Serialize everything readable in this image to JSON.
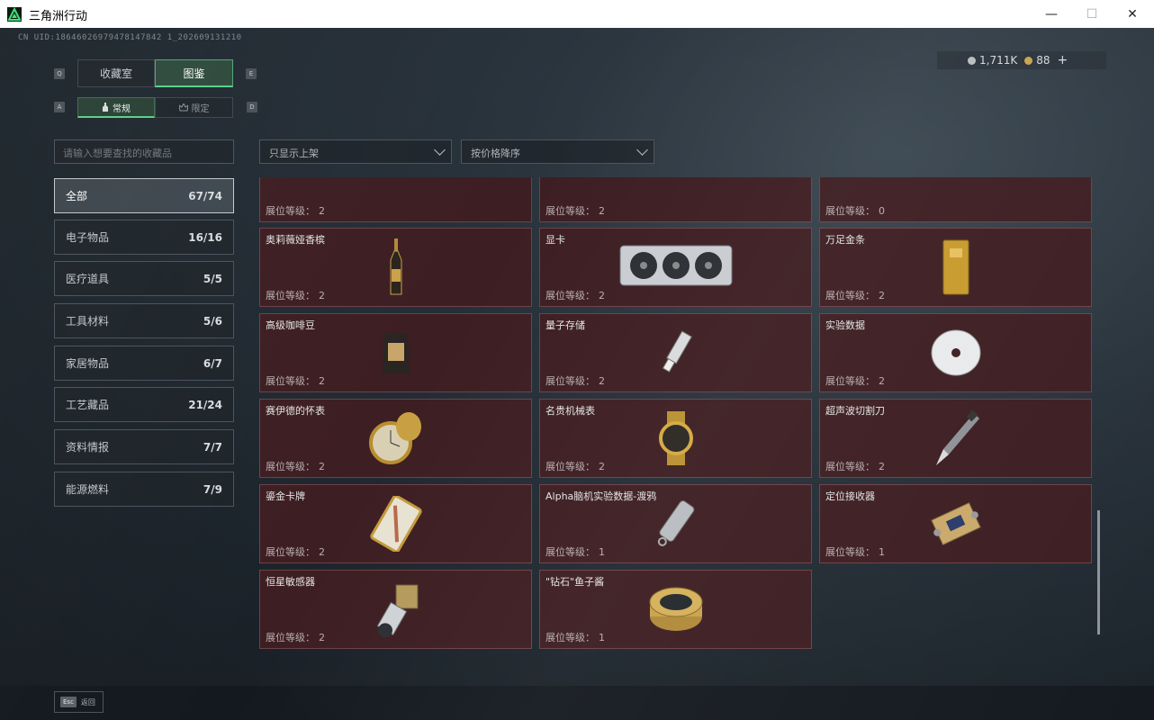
{
  "window": {
    "title": "三角洲行动",
    "minimize": "—",
    "maximize": "☐",
    "close": "✕"
  },
  "header": {
    "uid": "CN UID:18646026979478147842 1_202609131210"
  },
  "currency": {
    "silver": "1,711K",
    "gold": "88",
    "add": "+"
  },
  "keys": {
    "q": "Q",
    "e": "E",
    "a": "A",
    "d": "D"
  },
  "tabs": [
    {
      "label": "收藏室"
    },
    {
      "label": "图鉴"
    }
  ],
  "subtabs": [
    {
      "label": "常规"
    },
    {
      "label": "限定"
    }
  ],
  "search": {
    "placeholder": "请输入想要查找的收藏品"
  },
  "filters": {
    "shelf": "只显示上架",
    "sort": "按价格降序"
  },
  "categories": [
    {
      "label": "全部",
      "count": "67/74"
    },
    {
      "label": "电子物品",
      "count": "16/16"
    },
    {
      "label": "医疗道具",
      "count": "5/5"
    },
    {
      "label": "工具材料",
      "count": "5/6"
    },
    {
      "label": "家居物品",
      "count": "6/7"
    },
    {
      "label": "工艺藏品",
      "count": "21/24"
    },
    {
      "label": "资料情报",
      "count": "7/7"
    },
    {
      "label": "能源燃料",
      "count": "7/9"
    }
  ],
  "level_label": "展位等级：",
  "items": [
    {
      "name": "",
      "level": "2",
      "icon": "circuit-case-icon"
    },
    {
      "name": "",
      "level": "2",
      "icon": "horn-icon"
    },
    {
      "name": "",
      "level": "0",
      "icon": "map-icon"
    },
    {
      "name": "奥莉薇娅香槟",
      "level": "2",
      "icon": "champagne-icon"
    },
    {
      "name": "显卡",
      "level": "2",
      "icon": "graphics-card-icon"
    },
    {
      "name": "万足金条",
      "level": "2",
      "icon": "gold-bar-icon"
    },
    {
      "name": "高级咖啡豆",
      "level": "2",
      "icon": "coffee-bag-icon"
    },
    {
      "name": "量子存储",
      "level": "2",
      "icon": "usb-drive-icon"
    },
    {
      "name": "实验数据",
      "level": "2",
      "icon": "disc-icon"
    },
    {
      "name": "赛伊德的怀表",
      "level": "2",
      "icon": "pocket-watch-icon"
    },
    {
      "name": "名贵机械表",
      "level": "2",
      "icon": "wristwatch-icon"
    },
    {
      "name": "超声波切割刀",
      "level": "2",
      "icon": "cutter-icon"
    },
    {
      "name": "鎏金卡牌",
      "level": "2",
      "icon": "gold-card-icon"
    },
    {
      "name": "Alpha脑机实验数据-渡鸦",
      "level": "1",
      "icon": "data-cylinder-icon"
    },
    {
      "name": "定位接收器",
      "level": "1",
      "icon": "receiver-icon"
    },
    {
      "name": "恒星敏感器",
      "level": "2",
      "icon": "star-sensor-icon"
    },
    {
      "name": "\"钻石\"鱼子酱",
      "level": "1",
      "icon": "caviar-tin-icon"
    }
  ],
  "footer": {
    "esc_key": "Esc",
    "esc_label": "返回"
  }
}
